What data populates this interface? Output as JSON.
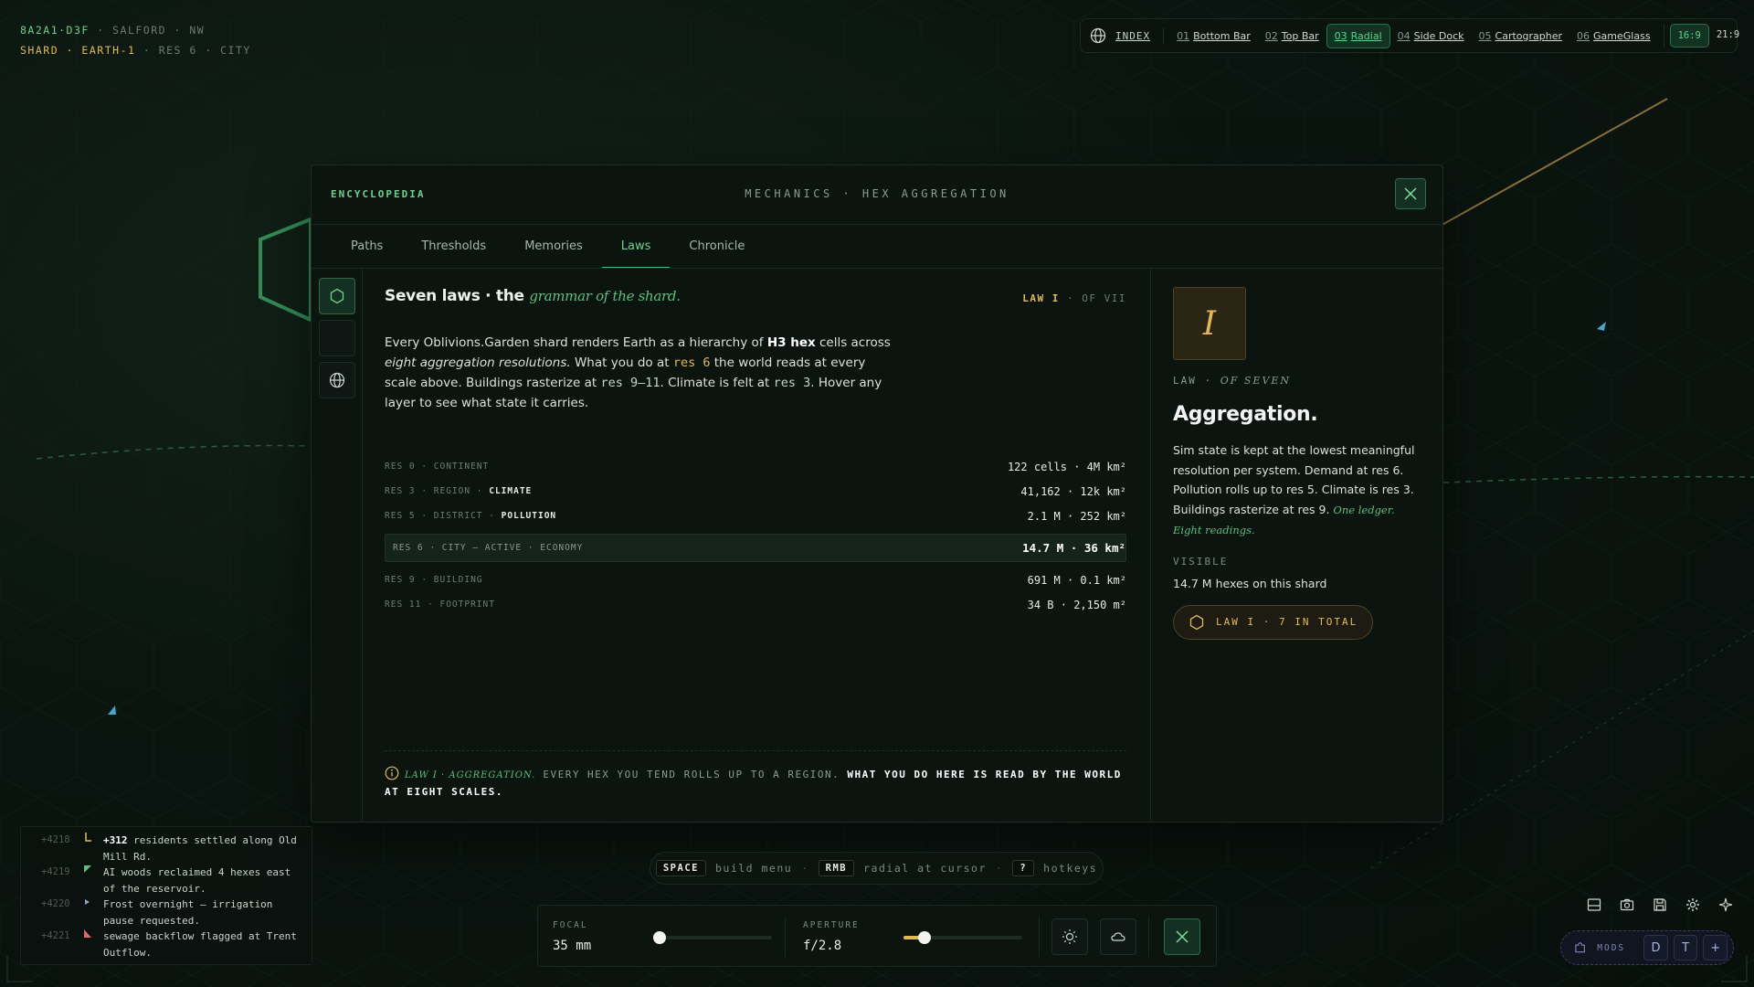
{
  "location": {
    "cell_id": "8A2A1·D3F",
    "place": "SALFORD",
    "direction": "NW",
    "shard": "SHARD",
    "world": "EARTH-1",
    "res": "RES 6",
    "scale": "CITY"
  },
  "topnav": {
    "index_label": "INDEX",
    "items": [
      {
        "num": "01",
        "label": "Bottom Bar",
        "active": false
      },
      {
        "num": "02",
        "label": "Top Bar",
        "active": false
      },
      {
        "num": "03",
        "label": "Radial",
        "active": true
      },
      {
        "num": "04",
        "label": "Side Dock",
        "active": false
      },
      {
        "num": "05",
        "label": "Cartographer",
        "active": false
      },
      {
        "num": "06",
        "label": "GameGlass",
        "active": false
      }
    ],
    "ratios": [
      "16:9",
      "21:9"
    ],
    "active_ratio": "16:9"
  },
  "panel": {
    "title": "ENCYCLOPEDIA",
    "subtitle": "MECHANICS · HEX AGGREGATION",
    "tabs": [
      "Paths",
      "Thresholds",
      "Memories",
      "Laws",
      "Chronicle"
    ],
    "active_tab": "Laws",
    "headline": "Seven laws · the",
    "headline_accent": "grammar of the shard.",
    "law_tag": "LAW I",
    "law_tag_of": "· OF VII",
    "intro": {
      "p1": "Every Oblivions.Garden shard renders Earth as a hierarchy of ",
      "b1": "H3 hex",
      "p2": " cells across ",
      "i1": "eight aggregation resolutions.",
      "p3": " What you do at ",
      "c1": "res 6",
      "p4": " the world reads at every scale above. Buildings rasterize at ",
      "c2": "res 9–11",
      "p5": ". Climate is felt at ",
      "c3": "res 3",
      "p6": ". Hover any layer to see what state it carries."
    },
    "resolutions": [
      {
        "label": "RES 0 · CONTINENT",
        "system": "",
        "value": "122 cells · 4M km²",
        "active": false
      },
      {
        "label": "RES 3 · REGION · ",
        "system": "CLIMATE",
        "value": "41,162 · 12k km²",
        "active": false
      },
      {
        "label": "RES 5 · DISTRICT · ",
        "system": "POLLUTION",
        "value": "2.1 M · 252 km²",
        "active": false
      },
      {
        "label": "RES 6 · CITY — ACTIVE · ECONOMY",
        "system": "",
        "value": "14.7 M · 36 km²",
        "active": true
      },
      {
        "label": "RES 9 · BUILDING",
        "system": "",
        "value": "691 M · 0.1 km²",
        "active": false
      },
      {
        "label": "RES 11 · FOOTPRINT",
        "system": "",
        "value": "34 B · 2,150 m²",
        "active": false
      }
    ],
    "footer": {
      "law": "LAW I · AGGREGATION.",
      "text": " EVERY HEX YOU TEND ROLLS UP TO A REGION. ",
      "bold": "WHAT YOU DO HERE IS READ BY THE WORLD AT EIGHT SCALES."
    },
    "side": {
      "numeral": "I",
      "law_word": "LAW",
      "of_seven": "OF SEVEN",
      "name": "Aggregation.",
      "desc": "Sim state is kept at the lowest meaningful resolution per system. Demand at res 6. Pollution rolls up to res 5. Climate is res 3. Buildings rasterize at res 9.",
      "desc_accent": "One ledger. Eight readings.",
      "visible_label": "VISIBLE",
      "visible_value": "14.7 M hexes on this shard",
      "pill": "LAW I · 7 IN TOTAL"
    }
  },
  "log": [
    {
      "id": "+4218",
      "icon": "arrow",
      "color": "#e2b85a",
      "bold": "+312",
      "text": " residents settled along Old Mill Rd."
    },
    {
      "id": "+4219",
      "icon": "flag",
      "color": "#5fbf80",
      "bold": "",
      "text": "AI woods reclaimed 4 hexes east of the reservoir."
    },
    {
      "id": "+4220",
      "icon": "dot",
      "color": "#8aa0d8",
      "bold": "",
      "text": "Frost overnight — irrigation pause requested."
    },
    {
      "id": "+4221",
      "icon": "flag",
      "color": "#d86a6a",
      "bold": "",
      "text": "sewage backflow flagged at Trent Outflow."
    }
  ],
  "hints": [
    {
      "key": "SPACE",
      "label": "build menu"
    },
    {
      "key": "RMB",
      "label": "radial at cursor"
    },
    {
      "key": "?",
      "label": "hotkeys"
    }
  ],
  "camera": {
    "focal_label": "FOCAL",
    "focal_value": "35 mm",
    "focal_level": 0.05,
    "aperture_label": "APERTURE",
    "aperture_value": "f/2.8",
    "aperture_level": 0.18
  },
  "mods": {
    "label": "MODS",
    "chips": [
      "D",
      "T",
      "+"
    ]
  },
  "colors": {
    "accent_green": "#5fbf80",
    "accent_gold": "#e2b85a",
    "background": "#0b1510"
  }
}
